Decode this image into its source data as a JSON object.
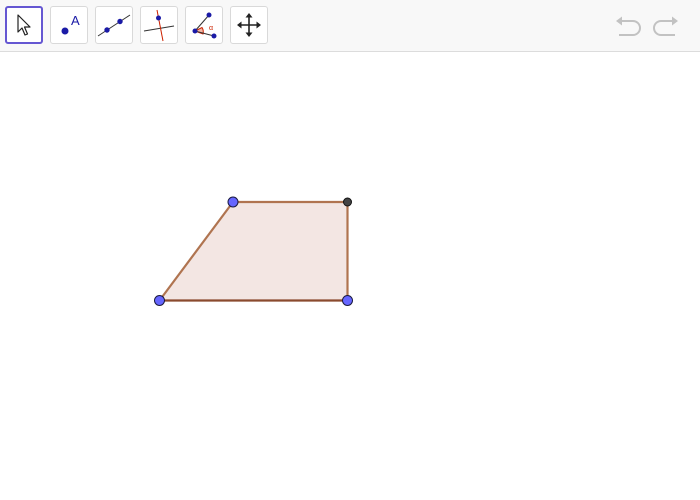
{
  "toolbar": {
    "tools": [
      {
        "name": "move-tool",
        "icon": "cursor-arrow-icon",
        "selected": true
      },
      {
        "name": "point-tool",
        "icon": "point-icon",
        "selected": false,
        "glyph": "A"
      },
      {
        "name": "line-tool",
        "icon": "line-through-two-points-icon",
        "selected": false
      },
      {
        "name": "perpendicular-line-tool",
        "icon": "perpendicular-line-icon",
        "selected": false
      },
      {
        "name": "angle-tool",
        "icon": "angle-icon",
        "selected": false,
        "glyph": "α"
      },
      {
        "name": "move-graphics-view-tool",
        "icon": "move-arrows-icon",
        "selected": false
      }
    ],
    "undo": {
      "icon": "undo-icon",
      "enabled": false
    },
    "redo": {
      "icon": "redo-icon",
      "enabled": false
    }
  },
  "colors": {
    "selection_border": "#6557d2",
    "polygon_fill": "#f3e6e3",
    "polygon_stroke": "#b07450",
    "point_fill": "#6666ff",
    "point_dependent_fill": "#444444",
    "icon_blue": "#1a1aa6",
    "icon_red": "#cc2200",
    "disabled_gray": "#c2c2c2"
  },
  "construction": {
    "shape": "quadrilateral",
    "points": [
      {
        "id": "top-left",
        "type": "free"
      },
      {
        "id": "top-right",
        "type": "dependent"
      },
      {
        "id": "bottom-right",
        "type": "free"
      },
      {
        "id": "bottom-left",
        "type": "free"
      }
    ]
  }
}
